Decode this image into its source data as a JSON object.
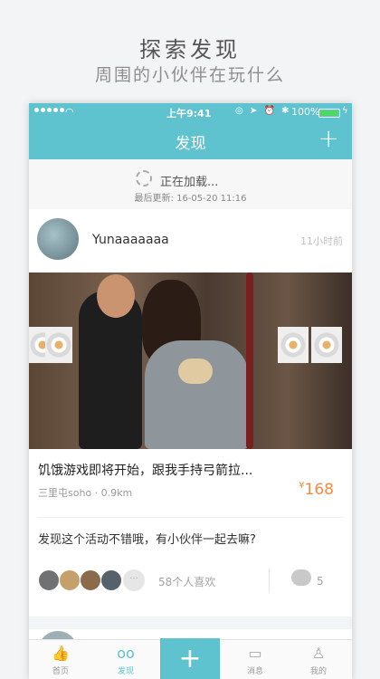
{
  "promo": {
    "title": "探索发现",
    "subtitle": "周围的小伙伴在玩什么"
  },
  "statusbar": {
    "time": "上午9:41",
    "battery": "100%"
  },
  "navbar": {
    "title": "发现",
    "add_label": "+"
  },
  "loading": {
    "text": "正在加载...",
    "last_update": "最后更新: 16-05-20 11:16"
  },
  "post": {
    "username": "Yunaaaaaaa",
    "time": "11小时前",
    "title": "饥饿游戏即将开始，跟我手持弓箭拉...",
    "location": "三里屯soho · 0.9km",
    "price_symbol": "¥",
    "price": "168",
    "comment": "发现这个活动不错哦，有小伙伴一起去嘛?",
    "likes_text": "58个人喜欢",
    "comment_count": "5"
  },
  "tabbar": {
    "items": [
      {
        "label": "首页",
        "icon": "thumbs-up-icon"
      },
      {
        "label": "发现",
        "icon": "glasses-icon"
      },
      {
        "label": "+",
        "icon": "plus-icon"
      },
      {
        "label": "消息",
        "icon": "chat-bubble-icon"
      },
      {
        "label": "我的",
        "icon": "person-icon"
      }
    ]
  },
  "colors": {
    "accent": "#5ec3cf",
    "price": "#f08a45"
  }
}
